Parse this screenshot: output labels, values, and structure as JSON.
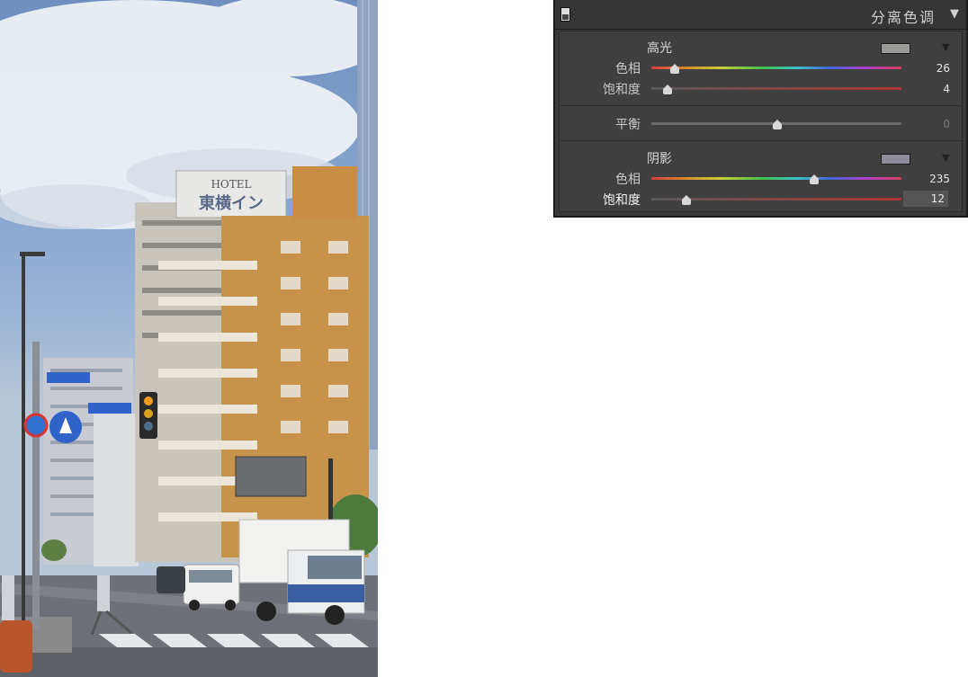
{
  "photo": {
    "hotel_sign": "HOTEL",
    "hotel_name": "東横イン"
  },
  "split_toning": {
    "title": "分离色调",
    "highlights": {
      "label": "高光",
      "swatch_color": "#9a9a96",
      "hue_label": "色相",
      "hue_value": "26",
      "saturation_label": "饱和度",
      "saturation_value": "4"
    },
    "balance": {
      "label": "平衡",
      "value": "0"
    },
    "shadows": {
      "label": "阴影",
      "swatch_color": "#8c8c9a",
      "hue_label": "色相",
      "hue_value": "235",
      "saturation_label": "饱和度",
      "saturation_value": "12"
    }
  }
}
